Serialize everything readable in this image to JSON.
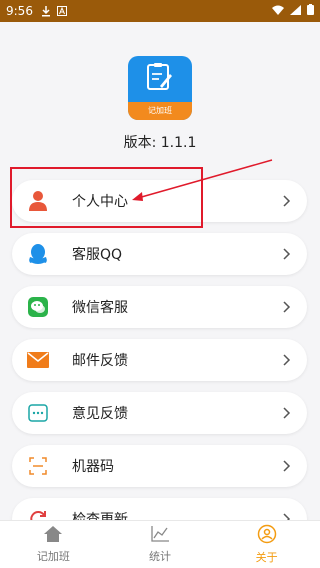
{
  "status_bar": {
    "time": "9:56",
    "bg_color": "#9a5a0a",
    "left_icons": [
      "download-icon",
      "a-icon"
    ],
    "right_icons": [
      "wifi-icon",
      "signal-icon",
      "battery-icon"
    ]
  },
  "app": {
    "icon_banner": "记加班",
    "version": "版本: 1.1.1"
  },
  "menu": {
    "items": [
      {
        "label": "个人中心",
        "icon": "person-icon",
        "color": "#e8573a"
      },
      {
        "label": "客服QQ",
        "icon": "qq-icon",
        "color": "#1e90e8"
      },
      {
        "label": "微信客服",
        "icon": "wechat-icon",
        "color": "#2bb34a"
      },
      {
        "label": "邮件反馈",
        "icon": "mail-icon",
        "color": "#f07c1a"
      },
      {
        "label": "意见反馈",
        "icon": "feedback-icon",
        "color": "#1aa6a6"
      },
      {
        "label": "机器码",
        "icon": "scan-icon",
        "color": "#f08a2a"
      },
      {
        "label": "检查更新",
        "icon": "update-icon",
        "color": "#e04040"
      }
    ]
  },
  "bottom_nav": {
    "items": [
      {
        "label": "记加班",
        "icon": "home-icon",
        "active": false
      },
      {
        "label": "统计",
        "icon": "chart-icon",
        "active": false
      },
      {
        "label": "关于",
        "icon": "about-icon",
        "active": true
      }
    ],
    "active_color": "#f39c12"
  },
  "annotation": {
    "color": "#e01a2b"
  }
}
